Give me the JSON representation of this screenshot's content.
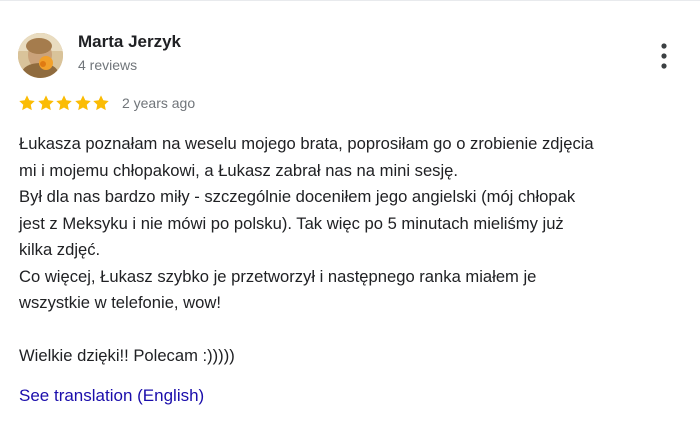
{
  "review": {
    "author": {
      "name": "Marta Jerzyk",
      "meta": "4 reviews",
      "avatar": "avatar-photo"
    },
    "more_icon": "more-vert-icon",
    "rating": {
      "stars": 5,
      "max_stars": 5,
      "star_color": "#fbbc04"
    },
    "timestamp": "2 years ago",
    "body": {
      "p1_l1": "Łukasza poznałam na weselu mojego brata, poprosiłam go o zrobienie zdjęcia",
      "p1_l2": "mi i mojemu chłopakowi, a Łukasz zabrał nas na mini sesję.",
      "p2_l1": "Był dla nas bardzo miły - szczególnie doceniłem jego angielski (mój chłopak",
      "p2_l2": "jest z Meksyku i nie mówi po polsku). Tak więc po 5 minutach mieliśmy już",
      "p2_l3": "kilka zdjęć.",
      "p3_l1": "Co więcej, Łukasz szybko je przetworzył i następnego ranka miałem je",
      "p3_l2": "wszystkie w telefonie, wow!",
      "p4_l1": "Wielkie dzięki!! Polecam :)))))"
    },
    "translate_link": "See translation (English)",
    "link_color": "#1a0dab"
  }
}
